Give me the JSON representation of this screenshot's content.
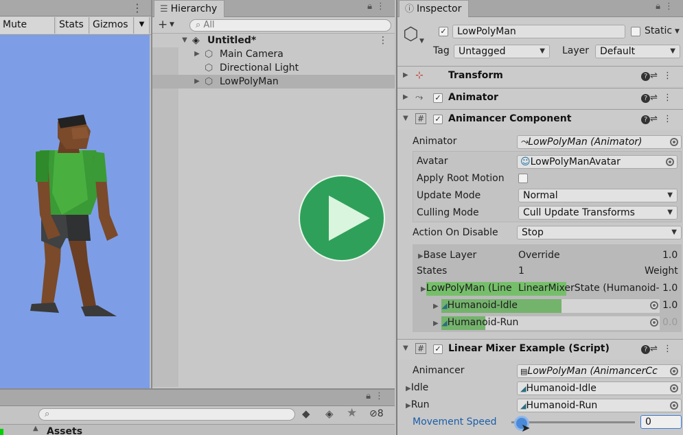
{
  "scene": {
    "toolbar": {
      "mute_audio": "Mute Audio",
      "stats": "Stats",
      "gizmos": "Gizmos"
    }
  },
  "hierarchy": {
    "tab_label": "Hierarchy",
    "search_placeholder": "All",
    "scene_name": "Untitled*",
    "items": [
      {
        "label": "Main Camera"
      },
      {
        "label": "Directional Light"
      },
      {
        "label": "LowPolyMan"
      }
    ]
  },
  "inspector": {
    "tab_label": "Inspector",
    "object_name": "LowPolyMan",
    "static_label": "Static",
    "tag_label": "Tag",
    "tag_value": "Untagged",
    "layer_label": "Layer",
    "layer_value": "Default",
    "components": {
      "transform": "Transform",
      "animator": "Animator",
      "animancer": "Animancer Component",
      "linear_mixer": "Linear Mixer Example (Script)"
    },
    "animancer": {
      "animator_label": "Animator",
      "animator_value": "LowPolyMan (Animator)",
      "avatar_label": "Avatar",
      "avatar_value": "LowPolyManAvatar",
      "apply_root_motion_label": "Apply Root Motion",
      "update_mode_label": "Update Mode",
      "update_mode_value": "Normal",
      "culling_mode_label": "Culling Mode",
      "culling_mode_value": "Cull Update Transforms",
      "action_on_disable_label": "Action On Disable",
      "action_on_disable_value": "Stop",
      "base_layer_label": "Base Layer",
      "base_layer_mode": "Override",
      "base_layer_weight": "1.0",
      "states_label": "States",
      "states_count": "1",
      "weight_label": "Weight",
      "mixer_state_left": "LowPolyMan (Line",
      "mixer_state_right": "LinearMixerState (Humanoid-",
      "mixer_weight": "1.0",
      "children": [
        {
          "name": "Humanoid-Idle",
          "weight": "1.0",
          "progress": 0.55
        },
        {
          "name": "Humanoid-Run",
          "weight": "0.0",
          "progress": 0.2
        }
      ]
    },
    "linear_mixer": {
      "animancer_label": "Animancer",
      "animancer_value": "LowPolyMan (AnimancerCc",
      "idle_label": "Idle",
      "idle_value": "Humanoid-Idle",
      "run_label": "Run",
      "run_value": "Humanoid-Run",
      "movement_speed_label": "Movement Speed",
      "movement_speed_value": "0"
    }
  },
  "project": {
    "assets_label": "Assets",
    "hidden_count": "8"
  }
}
